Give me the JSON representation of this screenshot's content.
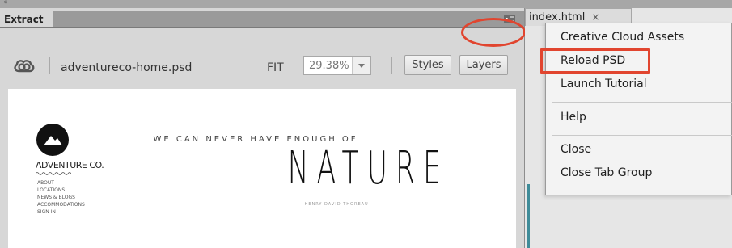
{
  "panel": {
    "tab_title": "Extract",
    "filename": "adventureco-home.psd",
    "fit_label": "FIT",
    "zoom_value": "29.38%",
    "styles_button": "Styles",
    "layers_button": "Layers"
  },
  "preview": {
    "brand": "ADVENTURE CO.",
    "nav": [
      "ABOUT",
      "LOCATIONS",
      "NEWS & BLOGS",
      "ACCOMMODATIONS",
      "SIGN IN"
    ],
    "tagline": "WE CAN NEVER HAVE ENOUGH OF",
    "headline": "NATURE",
    "subline": "— HENRY DAVID THOREAU —"
  },
  "document_tab": {
    "label": "index.html",
    "close_glyph": "×"
  },
  "menu": {
    "items": [
      "Creative Cloud Assets",
      "Reload PSD",
      "Launch Tutorial",
      "Help",
      "Close",
      "Close Tab Group"
    ]
  },
  "colors": {
    "highlight": "#e1452f",
    "teal": "#3f8c99"
  },
  "icons": {
    "collapse": "double-chevron-left-icon",
    "panel_menu": "panel-menu-icon",
    "creative_cloud": "creative-cloud-icon",
    "dropdown": "chevron-down-icon",
    "close": "close-icon",
    "logo": "mountain-logo-icon"
  }
}
